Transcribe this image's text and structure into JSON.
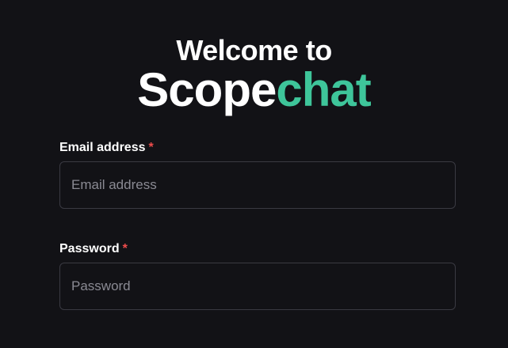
{
  "hero": {
    "welcome": "Welcome to",
    "brand_part1": "Scope",
    "brand_part2": "chat"
  },
  "colors": {
    "background": "#121216",
    "accent": "#3ec59a",
    "required": "#ef4c4c"
  },
  "form": {
    "email": {
      "label": "Email address",
      "required_marker": "*",
      "placeholder": "Email address",
      "value": ""
    },
    "password": {
      "label": "Password",
      "required_marker": "*",
      "placeholder": "Password",
      "value": ""
    }
  }
}
